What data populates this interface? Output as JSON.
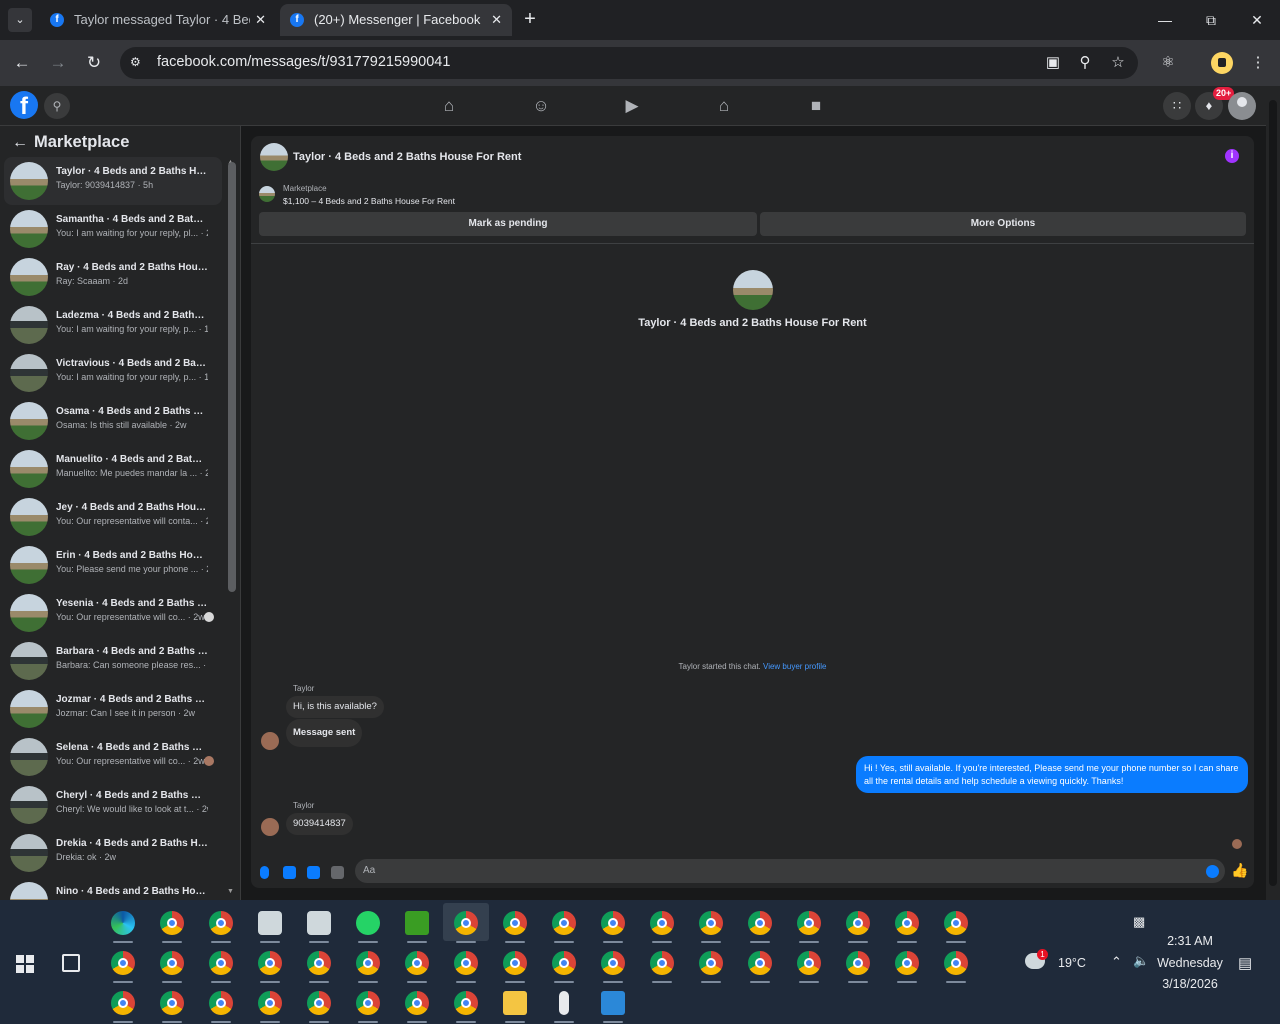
{
  "browser": {
    "tabs": [
      {
        "title": "Taylor messaged Taylor · 4 Beds",
        "active": false
      },
      {
        "title": "(20+) Messenger | Facebook",
        "active": true
      }
    ],
    "url": "facebook.com/messages/t/931779215990041"
  },
  "facebook": {
    "notification_count": "20+"
  },
  "sidebar": {
    "title": "Marketplace",
    "conversations": [
      {
        "name": "Taylor · 4 Beds and 2 Baths House For Rent",
        "preview": "Taylor: 9039414837 · 5h",
        "selected": true
      },
      {
        "name": "Samantha · 4 Beds and 2 Baths House For Rent",
        "preview": "You: I am waiting for your reply, pl... · 2d"
      },
      {
        "name": "Ray · 4 Beds and 2 Baths House For Rent",
        "preview": "Ray: Scaaam · 2d"
      },
      {
        "name": "Ladezma · 4 Beds and 2 Baths House For Rent",
        "preview": "You: I am waiting for your reply, p... · 1w"
      },
      {
        "name": "Victravious · 4 Beds and 2 Baths House For Rent",
        "preview": "You: I am waiting for your reply, p... · 1w"
      },
      {
        "name": "Osama · 4 Beds and 2 Baths House For Rent",
        "preview": "Osama: Is this still available · 2w"
      },
      {
        "name": "Manuelito · 4 Beds and 2 Baths House For Rent",
        "preview": "Manuelito: Me puedes mandar la ... · 2w"
      },
      {
        "name": "Jey · 4 Beds and 2 Baths House For Rent",
        "preview": "You: Our representative will conta... · 2w"
      },
      {
        "name": "Erin · 4 Beds and 2 Baths House For Rent",
        "preview": "You: Please send me your phone ... · 2w"
      },
      {
        "name": "Yesenia · 4 Beds and 2 Baths House For Rent",
        "preview": "You: Our representative will co... · 2w",
        "read_avatar": "gray"
      },
      {
        "name": "Barbara · 4 Beds and 2 Baths House For Rent",
        "preview": "Barbara: Can someone please res... · 2w"
      },
      {
        "name": "Jozmar · 4 Beds and 2 Baths House For Rent",
        "preview": "Jozmar: Can I see it in person · 2w"
      },
      {
        "name": "Selena · 4 Beds and 2 Baths House For Rent",
        "preview": "You: Our representative will co... · 2w",
        "read_avatar": "tan"
      },
      {
        "name": "Cheryl · 4 Beds and 2 Baths House For Rent",
        "preview": "Cheryl: We would like to look at t... · 2w"
      },
      {
        "name": "Drekia · 4 Beds and 2 Baths House For Rent",
        "preview": "Drekia: ok · 2w"
      },
      {
        "name": "Nino · 4 Beds and 2 Baths House For Rent",
        "preview": "",
        "read_avatar": "gray"
      }
    ]
  },
  "chat": {
    "title": "Taylor · 4 Beds and 2 Baths House For Rent",
    "marketplace_label": "Marketplace",
    "listing": "$1,100 – 4 Beds and 2 Baths House For Rent",
    "mark_pending": "Mark as pending",
    "more_options": "More Options",
    "center_name": "Taylor · 4 Beds and 2 Baths House For Rent",
    "started_text": "Taylor started this chat.",
    "view_profile": "View buyer profile",
    "messages": [
      {
        "sender": "Taylor",
        "text": "Hi, is this available?"
      },
      {
        "text": "Message sent"
      },
      {
        "outgoing": true,
        "text": "Hi ! Yes, still available. If you're interested, Please send me your phone number so I can share all the rental details and help schedule a viewing quickly. Thanks!"
      },
      {
        "sender": "Taylor",
        "text": "9039414837"
      }
    ],
    "composer_placeholder": "Aa"
  },
  "taskbar": {
    "temperature": "19°C",
    "weather_badge": "1",
    "time": "2:31 AM",
    "day": "Wednesday",
    "date": "3/18/2026"
  }
}
